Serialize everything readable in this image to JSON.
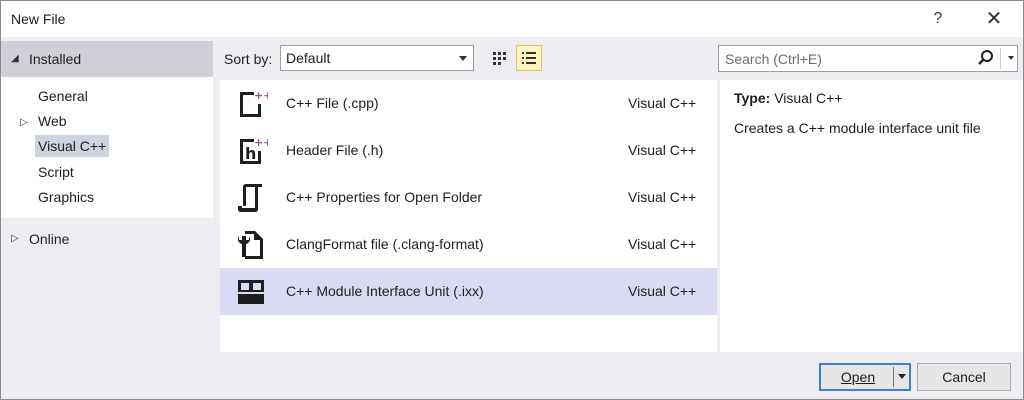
{
  "window": {
    "title": "New File",
    "help": "?",
    "close": "✕"
  },
  "tree": {
    "installed": "Installed",
    "children": [
      {
        "label": "General",
        "expander": false
      },
      {
        "label": "Web",
        "expander": true
      },
      {
        "label": "Visual C++",
        "expander": false,
        "selected": true
      },
      {
        "label": "Script",
        "expander": false
      },
      {
        "label": "Graphics",
        "expander": false
      }
    ],
    "online": "Online"
  },
  "sort": {
    "label": "Sort by:",
    "value": "Default"
  },
  "search": {
    "placeholder": "Search (Ctrl+E)"
  },
  "templates": [
    {
      "name": "C++ File (.cpp)",
      "language": "Visual C++",
      "icon": "cpp-file-icon"
    },
    {
      "name": "Header File (.h)",
      "language": "Visual C++",
      "icon": "header-file-icon"
    },
    {
      "name": "C++ Properties for Open Folder",
      "language": "Visual C++",
      "icon": "properties-icon"
    },
    {
      "name": "ClangFormat file (.clang-format)",
      "language": "Visual C++",
      "icon": "clang-format-icon"
    },
    {
      "name": "C++ Module Interface Unit (.ixx)",
      "language": "Visual C++",
      "icon": "module-icon",
      "selected": true
    }
  ],
  "details": {
    "type_label": "Type:",
    "type_value": "Visual C++",
    "description": "Creates a C++ module interface unit file"
  },
  "buttons": {
    "open": "Open",
    "cancel": "Cancel"
  }
}
